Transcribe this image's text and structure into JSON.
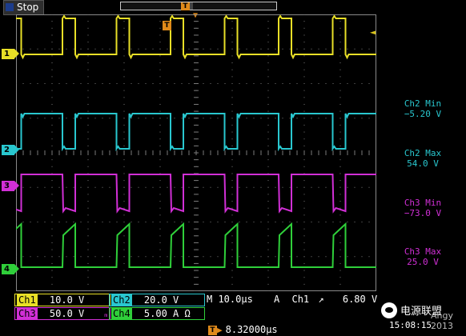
{
  "status": {
    "state": "Stop"
  },
  "trigger_marker": "T",
  "colors": {
    "ch1": "#e8df27",
    "ch2": "#29c7cf",
    "ch3": "#d12fd6",
    "ch4": "#2fcf3a",
    "trigger": "#e08a1a",
    "grid": "#7a7a7a"
  },
  "channels": [
    {
      "id": "1",
      "color": "#e8df27"
    },
    {
      "id": "2",
      "color": "#29c7cf"
    },
    {
      "id": "3",
      "color": "#d12fd6"
    },
    {
      "id": "4",
      "color": "#2fcf3a"
    }
  ],
  "measurements": [
    {
      "name": "Ch2 Min",
      "value": "−5.20 V",
      "color": "#29c7cf"
    },
    {
      "name": "Ch2 Max",
      "value": "54.0 V",
      "color": "#29c7cf"
    },
    {
      "name": "Ch3 Min",
      "value": "−73.0 V",
      "color": "#d12fd6"
    },
    {
      "name": "Ch3 Max",
      "value": "25.0 V",
      "color": "#d12fd6"
    }
  ],
  "readout": {
    "ch1": {
      "label": "Ch1",
      "value": "10.0 V"
    },
    "ch2": {
      "label": "Ch2",
      "value": "20.0 V"
    },
    "ch3": {
      "label": "Ch3",
      "value": "50.0 V"
    },
    "ch4": {
      "label": "Ch4",
      "value": "5.00 A Ω"
    },
    "bw_mark": "ₘ",
    "timebase": "M 10.0µs",
    "acq": "A",
    "trigger_src": "Ch1",
    "trigger_slope": "↗",
    "trigger_level": "6.80 V",
    "horizontal_position": "8.32000µs"
  },
  "watermark": {
    "name": "电源联盟",
    "url": "Angy 2013"
  },
  "clock": "15:08:15"
}
